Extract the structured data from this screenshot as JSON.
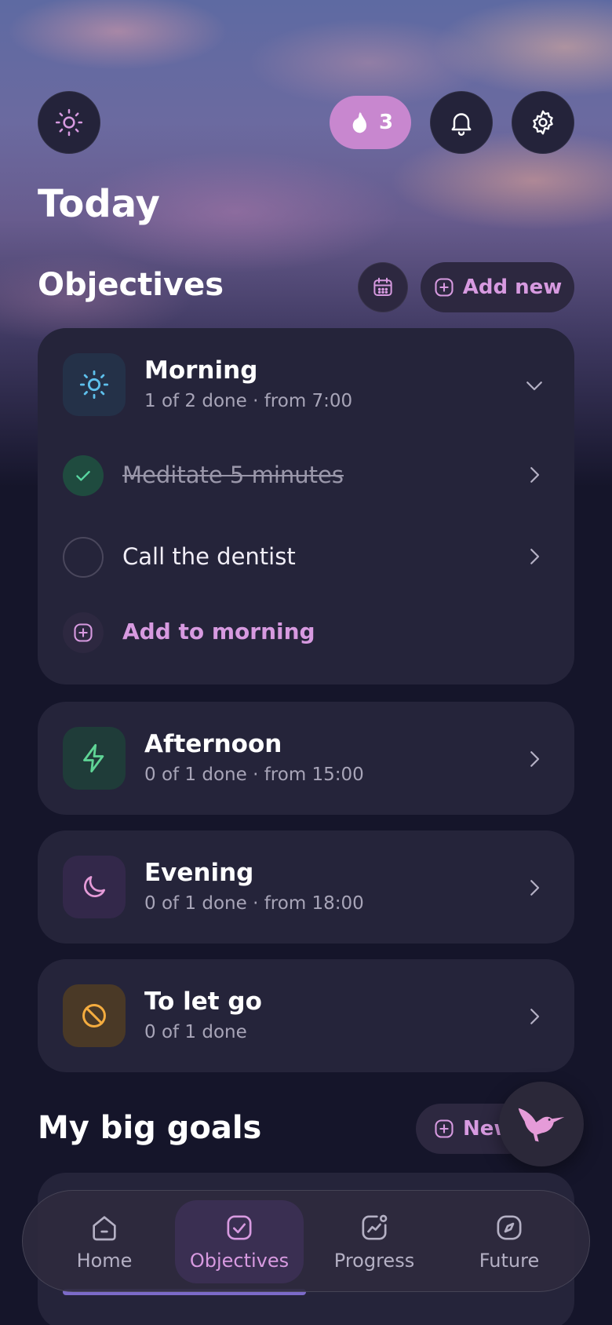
{
  "colors": {
    "accent": "#d79ae0",
    "streak": "#c887cf",
    "card": "#25243a",
    "background": "#15152a"
  },
  "header": {
    "theme_icon": "sun-icon",
    "streak_count": "3",
    "streak_icon": "flame-icon",
    "bell_icon": "bell-icon",
    "settings_icon": "gear-icon"
  },
  "page_title": "Today",
  "objectives": {
    "heading": "Objectives",
    "calendar_icon": "calendar-icon",
    "add_new_label": "Add new",
    "morning": {
      "title": "Morning",
      "subtitle": "1 of 2 done · from 7:00",
      "tasks": [
        {
          "label": "Meditate 5 minutes",
          "done": true
        },
        {
          "label": "Call the dentist",
          "done": false
        }
      ],
      "add_label": "Add to morning"
    },
    "sections": [
      {
        "title": "Afternoon",
        "subtitle": "0 of 1 done · from 15:00",
        "icon": "lightning-icon"
      },
      {
        "title": "Evening",
        "subtitle": "0 of 1 done · from 18:00",
        "icon": "moon-icon"
      },
      {
        "title": "To let go",
        "subtitle": "0 of 1 done",
        "icon": "ban-icon"
      }
    ]
  },
  "big_goals": {
    "heading": "My big goals",
    "new_label": "New"
  },
  "nav": {
    "items": [
      {
        "label": "Home",
        "icon": "home-icon"
      },
      {
        "label": "Objectives",
        "icon": "check-square-icon",
        "active": true
      },
      {
        "label": "Progress",
        "icon": "chart-icon"
      },
      {
        "label": "Future",
        "icon": "compass-icon"
      }
    ]
  }
}
